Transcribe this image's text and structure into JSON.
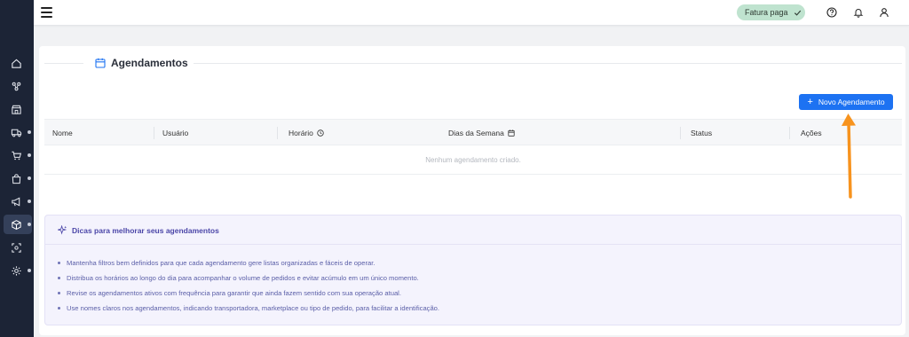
{
  "topbar": {
    "status_badge": "Fatura paga",
    "icons": [
      "help-icon",
      "bell-icon",
      "user-icon"
    ]
  },
  "sidebar": {
    "items": [
      {
        "icon": "home-icon",
        "active": false,
        "dot": false
      },
      {
        "icon": "integrations-icon",
        "active": false,
        "dot": false
      },
      {
        "icon": "store-icon",
        "active": false,
        "dot": false
      },
      {
        "icon": "truck-icon",
        "active": false,
        "dot": true
      },
      {
        "icon": "cart-icon",
        "active": false,
        "dot": true
      },
      {
        "icon": "bag-icon",
        "active": false,
        "dot": true
      },
      {
        "icon": "megaphone-icon",
        "active": false,
        "dot": true
      },
      {
        "icon": "box-icon",
        "active": true,
        "dot": true
      },
      {
        "icon": "scan-icon",
        "active": false,
        "dot": false
      },
      {
        "icon": "gear-icon",
        "active": false,
        "dot": true
      }
    ]
  },
  "page": {
    "title": "Agendamentos",
    "new_button": "Novo Agendamento"
  },
  "table": {
    "columns": [
      "Nome",
      "Usuário",
      "Horário",
      "Dias da Semana",
      "Status",
      "Ações"
    ],
    "empty_text": "Nenhum agendamento criado."
  },
  "tips": {
    "title": "Dicas para melhorar seus agendamentos",
    "items": [
      "Mantenha filtros bem definidos para que cada agendamento gere listas organizadas e fáceis de operar.",
      "Distribua os horários ao longo do dia para acompanhar o volume de pedidos e evitar acúmulo em um único momento.",
      "Revise os agendamentos ativos com frequência para garantir que ainda fazem sentido com sua operação atual.",
      "Use nomes claros nos agendamentos, indicando transportadora, marketplace ou tipo de pedido, para facilitar a identificação."
    ]
  },
  "colors": {
    "primary": "#1d72f2",
    "sidebar": "#1c2436",
    "badge_bg": "#bfe3cf",
    "tips_bg": "#f4f3fd",
    "annotation": "#f7931e"
  }
}
